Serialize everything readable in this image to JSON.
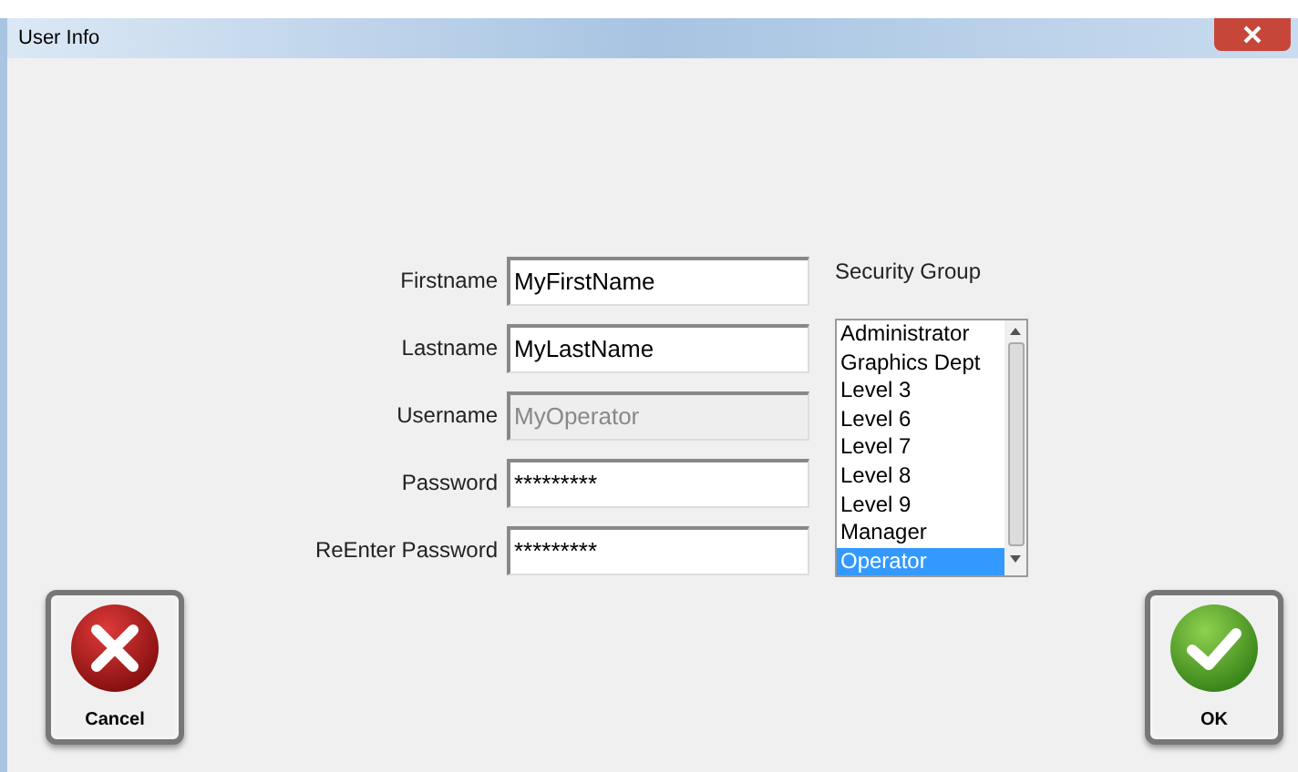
{
  "window": {
    "title": "User Info"
  },
  "fields": [
    {
      "label": "Firstname",
      "value": "MyFirstName",
      "disabled": false
    },
    {
      "label": "Lastname",
      "value": "MyLastName",
      "disabled": false
    },
    {
      "label": "Username",
      "value": "MyOperator",
      "disabled": true
    },
    {
      "label": "Password",
      "value": "*********",
      "disabled": false
    },
    {
      "label": "ReEnter Password",
      "value": "*********",
      "disabled": false
    }
  ],
  "security_group": {
    "label": "Security Group",
    "items": [
      {
        "label": "Administrator",
        "selected": false
      },
      {
        "label": "Graphics Dept",
        "selected": false
      },
      {
        "label": "Level 3",
        "selected": false
      },
      {
        "label": "Level 6",
        "selected": false
      },
      {
        "label": "Level 7",
        "selected": false
      },
      {
        "label": "Level 8",
        "selected": false
      },
      {
        "label": "Level 9",
        "selected": false
      },
      {
        "label": "Manager",
        "selected": false
      },
      {
        "label": "Operator",
        "selected": true
      }
    ]
  },
  "buttons": [
    {
      "kind": "cancel",
      "label": "Cancel"
    },
    {
      "kind": "ok",
      "label": "OK"
    }
  ]
}
